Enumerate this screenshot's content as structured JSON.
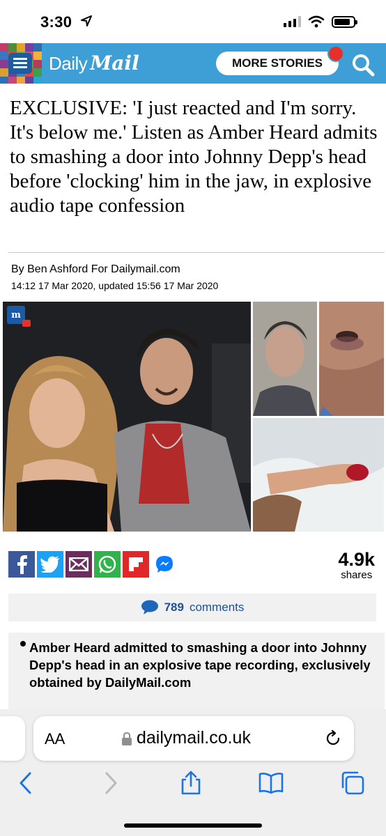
{
  "status_bar": {
    "time": "3:30"
  },
  "header": {
    "logo_daily": "Daily",
    "logo_mail": "Mail",
    "more_stories_label": "MORE STORIES",
    "brand_color": "#3d9fd6"
  },
  "article": {
    "headline": "EXCLUSIVE: 'I just reacted and I'm sorry. It's below me.' Listen as Amber Heard admits to smashing a door into Johnny Depp's head before 'clocking' him in the jaw, in explosive audio tape confession",
    "byline": "By Ben Ashford For Dailymail.com",
    "dateline": "14:12 17 Mar 2020, updated 15:56 17 Mar 2020",
    "share_count": "4.9k",
    "share_label": "shares",
    "comment_count": "789",
    "comment_label": "comments",
    "summary_bullet": "Amber Heard admitted to smashing a door into Johnny Depp's head in an explosive tape recording, exclusively obtained by DailyMail.com"
  },
  "share_buttons": [
    {
      "icon": "facebook-icon",
      "color": "#3b5998"
    },
    {
      "icon": "twitter-icon",
      "color": "#1da1f2"
    },
    {
      "icon": "email-icon",
      "color": "#6b2c5e"
    },
    {
      "icon": "whatsapp-icon",
      "color": "#2fb34a"
    },
    {
      "icon": "flipboard-icon",
      "color": "#e12828"
    },
    {
      "icon": "messenger-icon",
      "color": "#ffffff"
    }
  ],
  "browser": {
    "aa_label": "AA",
    "url": "dailymail.co.uk"
  }
}
